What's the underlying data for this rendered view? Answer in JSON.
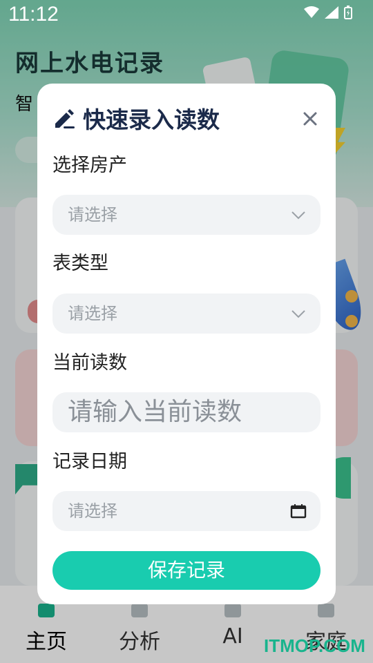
{
  "status_bar": {
    "time": "11:12"
  },
  "app": {
    "title": "网上水电记录",
    "subtitle": "智"
  },
  "modal": {
    "title": "快速录入读数",
    "fields": [
      {
        "label": "选择房产",
        "placeholder": "请选择",
        "type": "select"
      },
      {
        "label": "表类型",
        "placeholder": "请选择",
        "type": "select"
      },
      {
        "label": "当前读数",
        "placeholder": "请输入当前读数",
        "type": "input"
      },
      {
        "label": "记录日期",
        "placeholder": "请选择",
        "type": "date"
      }
    ],
    "save_label": "保存记录"
  },
  "tabbar": {
    "items": [
      {
        "label": "主页",
        "icon": "home-icon",
        "active": true
      },
      {
        "label": "分析",
        "icon": "chart-icon",
        "active": false
      },
      {
        "label": "AI",
        "icon": "ai-icon",
        "active": false
      },
      {
        "label": "家庭",
        "icon": "family-icon",
        "active": false
      }
    ]
  },
  "watermark": "ITMOP.COM",
  "colors": {
    "accent": "#19ccaf",
    "title": "#1b2a4a",
    "field_bg": "#f1f3f5"
  }
}
